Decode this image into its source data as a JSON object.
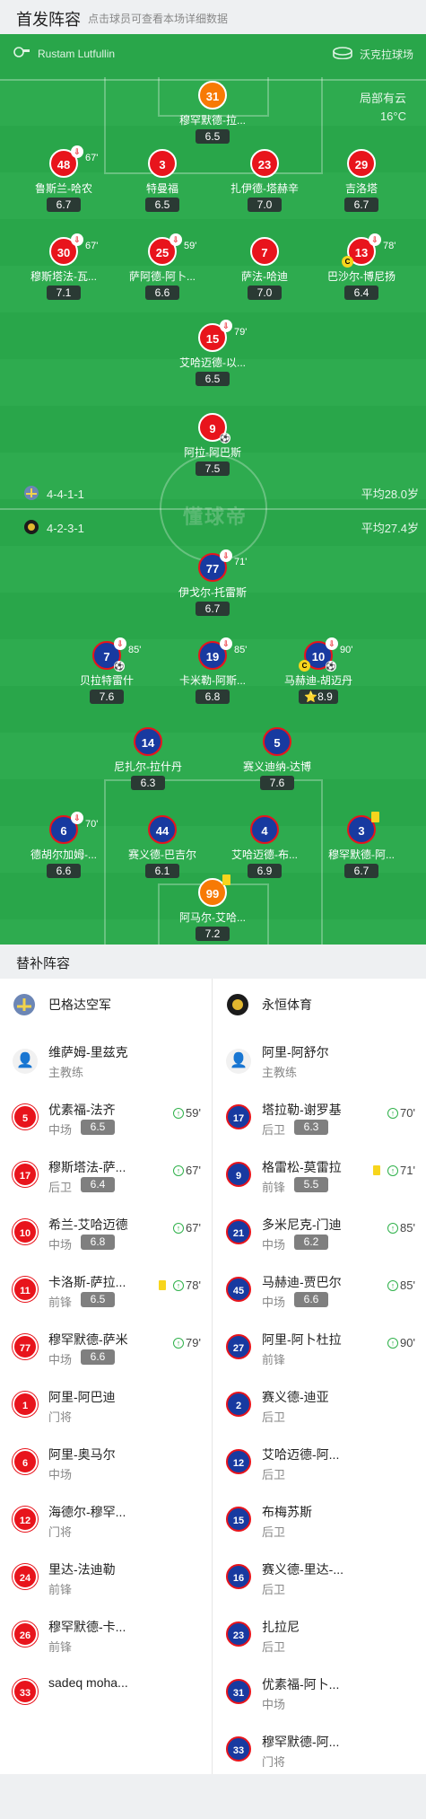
{
  "header": {
    "title": "首发阵容",
    "hint": "点击球员可查看本场详细数据"
  },
  "pitch": {
    "referee": "Rustam Lutfullin",
    "stadium": "沃克拉球场",
    "weather": "局部有云",
    "temperature": "16°C",
    "watermark": "懂球帝",
    "home": {
      "formation": "4-4-1-1",
      "avg_age": "平均28.0岁"
    },
    "away": {
      "formation": "4-2-3-1",
      "avg_age": "平均27.4岁"
    }
  },
  "home_players": [
    {
      "num": "31",
      "name": "穆罕默德-拉...",
      "rating": "6.5",
      "kind": "gk"
    },
    {
      "num": "48",
      "name": "鲁斯兰-哈农",
      "rating": "6.7",
      "sub": "67'"
    },
    {
      "num": "3",
      "name": "特曼福",
      "rating": "6.5"
    },
    {
      "num": "23",
      "name": "扎伊德-塔赫辛",
      "rating": "7.0"
    },
    {
      "num": "29",
      "name": "吉洛塔",
      "rating": "6.7"
    },
    {
      "num": "30",
      "name": "穆斯塔法-瓦...",
      "rating": "7.1",
      "sub": "67'"
    },
    {
      "num": "25",
      "name": "萨阿德-阿卜...",
      "rating": "6.6",
      "sub": "59'"
    },
    {
      "num": "7",
      "name": "萨法-哈迪",
      "rating": "7.0"
    },
    {
      "num": "13",
      "name": "巴沙尔-博尼扬",
      "rating": "6.4",
      "sub": "78'",
      "captain": "C"
    },
    {
      "num": "15",
      "name": "艾哈迈德-以...",
      "rating": "6.5",
      "sub": "79'"
    },
    {
      "num": "9",
      "name": "阿拉-阿巴斯",
      "rating": "7.5"
    }
  ],
  "away_players": [
    {
      "num": "77",
      "name": "伊戈尔-托雷斯",
      "rating": "6.7",
      "sub": "71'"
    },
    {
      "num": "7",
      "name": "贝拉特雷什",
      "rating": "7.6",
      "sub": "85'"
    },
    {
      "num": "19",
      "name": "卡米勒-阿斯...",
      "rating": "6.8",
      "sub": "85'"
    },
    {
      "num": "10",
      "name": "马赫迪-胡迈丹",
      "rating": "8.9",
      "sub": "90'",
      "captain": "C"
    },
    {
      "num": "14",
      "name": "尼扎尔-拉什丹",
      "rating": "6.3"
    },
    {
      "num": "5",
      "name": "赛义迪纳-达博",
      "rating": "7.6"
    },
    {
      "num": "6",
      "name": "德胡尔加姆-...",
      "rating": "6.6",
      "sub": "70'"
    },
    {
      "num": "44",
      "name": "赛义德-巴吉尔",
      "rating": "6.1"
    },
    {
      "num": "4",
      "name": "艾哈迈德-布...",
      "rating": "6.9"
    },
    {
      "num": "3",
      "name": "穆罕默德-阿...",
      "rating": "6.7"
    },
    {
      "num": "99",
      "name": "阿马尔-艾哈...",
      "rating": "7.2",
      "kind": "gk"
    }
  ],
  "subs": {
    "title": "替补阵容",
    "home": {
      "team": "巴格达空军",
      "coach": {
        "name": "维萨姆-里兹克",
        "role": "主教练"
      },
      "players": [
        {
          "num": "5",
          "name": "优素福-法齐",
          "pos": "中场",
          "rating": "6.5",
          "in": "59'"
        },
        {
          "num": "17",
          "name": "穆斯塔法-萨...",
          "pos": "后卫",
          "rating": "6.4",
          "in": "67'"
        },
        {
          "num": "10",
          "name": "希兰-艾哈迈德",
          "pos": "中场",
          "rating": "6.8",
          "in": "67'"
        },
        {
          "num": "11",
          "name": "卡洛斯-萨拉...",
          "pos": "前锋",
          "rating": "6.5",
          "in": "78'",
          "card": "yellow"
        },
        {
          "num": "77",
          "name": "穆罕默德-萨米",
          "pos": "中场",
          "rating": "6.6",
          "in": "79'"
        },
        {
          "num": "1",
          "name": "阿里-阿巴迪",
          "pos": "门将"
        },
        {
          "num": "6",
          "name": "阿里-奥马尔",
          "pos": "中场"
        },
        {
          "num": "12",
          "name": "海德尔-穆罕...",
          "pos": "门将"
        },
        {
          "num": "24",
          "name": "里达-法迪勒",
          "pos": "前锋"
        },
        {
          "num": "26",
          "name": "穆罕默德-卡...",
          "pos": "前锋"
        },
        {
          "num": "33",
          "name": "sadeq moha...",
          "pos": ""
        }
      ]
    },
    "away": {
      "team": "永恒体育",
      "coach": {
        "name": "阿里-阿舒尔",
        "role": "主教练"
      },
      "players": [
        {
          "num": "17",
          "name": "塔拉勒-谢罗基",
          "pos": "后卫",
          "rating": "6.3",
          "in": "70'"
        },
        {
          "num": "9",
          "name": "格雷松-莫雷拉",
          "pos": "前锋",
          "rating": "5.5",
          "in": "71'",
          "card": "yellow"
        },
        {
          "num": "21",
          "name": "多米尼克-门迪",
          "pos": "中场",
          "rating": "6.2",
          "in": "85'"
        },
        {
          "num": "45",
          "name": "马赫迪-贾巴尔",
          "pos": "中场",
          "rating": "6.6",
          "in": "85'"
        },
        {
          "num": "27",
          "name": "阿里-阿卜杜拉",
          "pos": "前锋",
          "in": "90'"
        },
        {
          "num": "2",
          "name": "赛义德-迪亚",
          "pos": "后卫"
        },
        {
          "num": "12",
          "name": "艾哈迈德-阿...",
          "pos": "后卫"
        },
        {
          "num": "15",
          "name": "布梅苏斯",
          "pos": "后卫"
        },
        {
          "num": "16",
          "name": "赛义德-里达-...",
          "pos": "后卫"
        },
        {
          "num": "23",
          "name": "扎拉尼",
          "pos": "后卫"
        },
        {
          "num": "31",
          "name": "优素福-阿卜...",
          "pos": "中场"
        },
        {
          "num": "33",
          "name": "穆罕默德-阿...",
          "pos": "门将"
        }
      ]
    }
  },
  "colors": {
    "pitch": "#29a64a",
    "home": "#e8141c",
    "away": "#183aa0",
    "gk": "#f77a05"
  }
}
